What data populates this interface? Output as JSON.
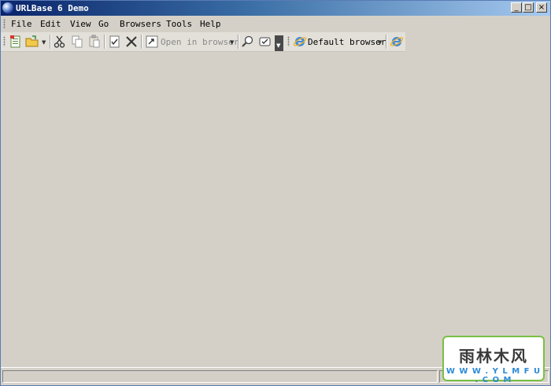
{
  "window": {
    "title": "URLBase 6 Demo"
  },
  "menu": {
    "items": [
      "File",
      "Edit",
      "View",
      "Go",
      "Browsers",
      "Tools",
      "Help"
    ]
  },
  "toolbar": {
    "open_in_browser_label": "Open in browser",
    "default_browser_label": "Default browser",
    "icons": [
      "new-icon",
      "open-folder-icon",
      "cut-icon",
      "copy-icon",
      "paste-icon",
      "checklist-icon",
      "delete-icon",
      "open-in-browser-icon",
      "find-icon",
      "check-links-icon",
      "internet-explorer-icon"
    ]
  },
  "watermark": {
    "title": "雨林木风",
    "url": "W W W . Y L M F U . C O M"
  },
  "colors": {
    "titlebar_start": "#0a246a",
    "titlebar_end": "#a6caf0",
    "face": "#d4d0c8",
    "watermark_border": "#7ac043",
    "watermark_url": "#2b8ad6"
  }
}
